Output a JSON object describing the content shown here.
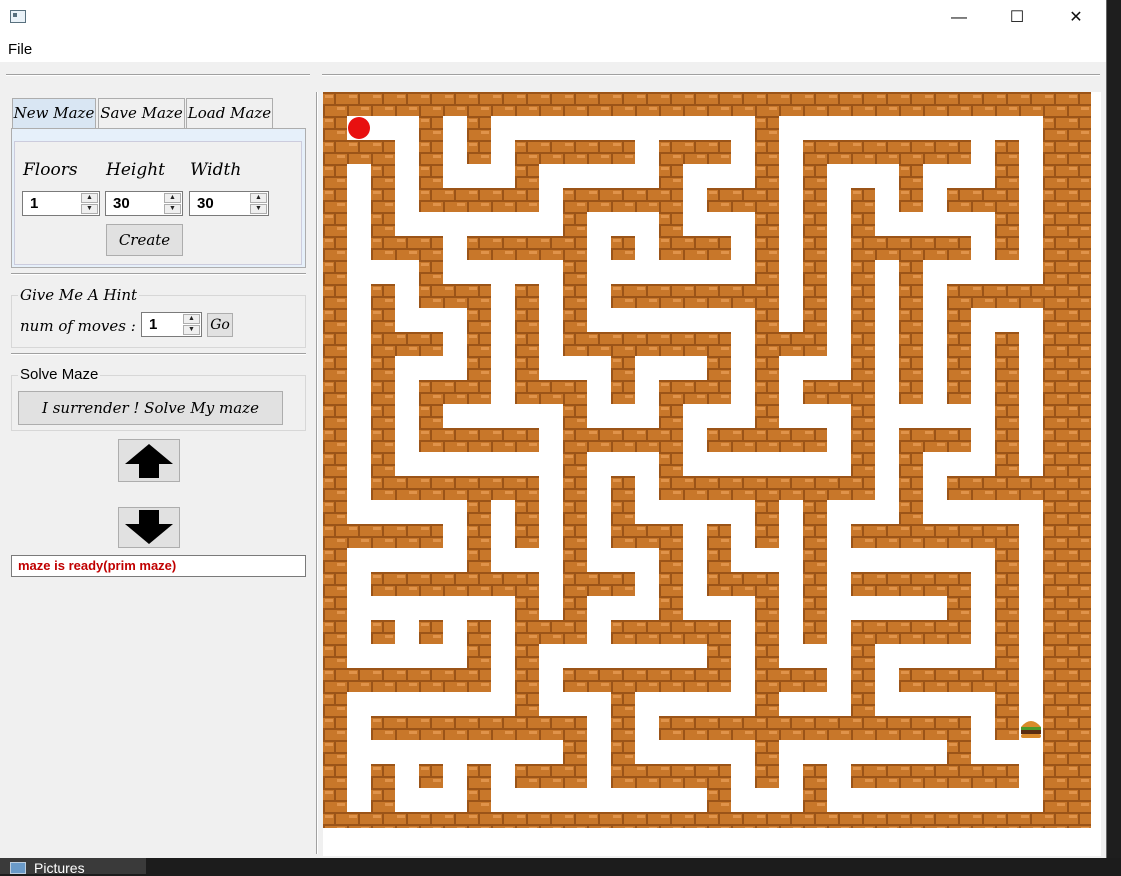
{
  "window": {
    "minimize_glyph": "—",
    "maximize_glyph": "☐",
    "close_glyph": "✕"
  },
  "menu": {
    "file": "File"
  },
  "tabs": [
    "New Maze",
    "Save Maze",
    "Load Maze"
  ],
  "new_maze": {
    "floors_label": "Floors",
    "height_label": "Height",
    "width_label": "Width",
    "floors_value": "1",
    "height_value": "30",
    "width_value": "30",
    "create_label": "Create"
  },
  "hint": {
    "title": "Give Me A Hint",
    "moves_label": "num of moves :",
    "moves_value": "1",
    "go_label": "Go"
  },
  "solve": {
    "title": "Solve Maze",
    "button_label": "I surrender ! Solve My maze"
  },
  "status": "maze  is ready(prim maze)",
  "maze": {
    "rows": 31,
    "cols": 32,
    "wall_color": "#c8772a",
    "path_color": "#ffffff",
    "player_color": "#e81010",
    "player": {
      "row": 1,
      "col": 1
    },
    "goal": {
      "row": 26,
      "col": 29,
      "icon": "hamburger-icon"
    }
  },
  "taskbar": {
    "label": "Pictures"
  },
  "colors": {
    "status_text": "#c00000",
    "active_tab": "#d9e6f3"
  }
}
